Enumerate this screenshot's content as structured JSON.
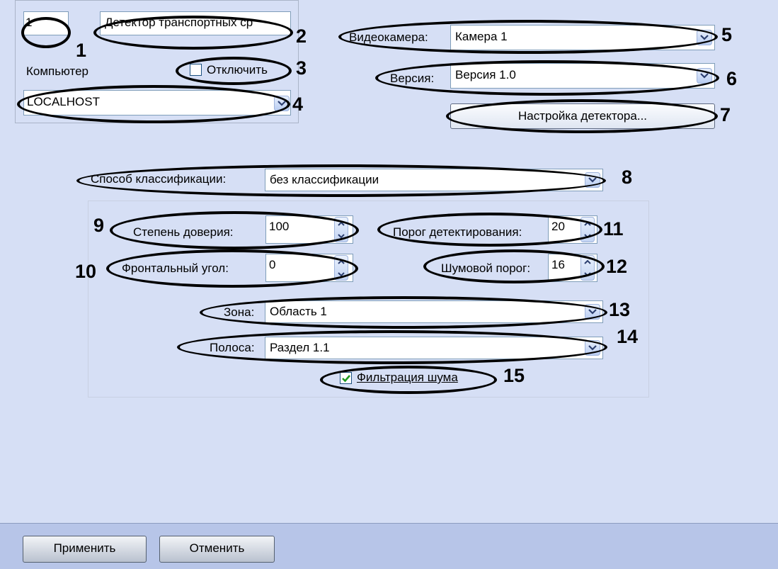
{
  "object_id": "1",
  "object_name": "Детектор транспортных ср",
  "computer": {
    "label": "Компьютер",
    "value": "LOCALHOST"
  },
  "disable": {
    "label": "Отключить",
    "checked": false
  },
  "camera": {
    "label": "Видеокамера:",
    "value": "Камера 1"
  },
  "version": {
    "label": "Версия:",
    "value": "Версия 1.0"
  },
  "detector_settings_button": "Настройка детектора...",
  "classification": {
    "label": "Способ классификации:",
    "value": "без классификации"
  },
  "confidence": {
    "label": "Степень доверия:",
    "value": "100"
  },
  "frontal_angle": {
    "label": "Фронтальный угол:",
    "value": "0"
  },
  "detection_threshold": {
    "label": "Порог детектирования:",
    "value": "20"
  },
  "noise_threshold": {
    "label": "Шумовой порог:",
    "value": "16"
  },
  "zone": {
    "label": "Зона:",
    "value": "Область 1"
  },
  "lane": {
    "label": "Полоса:",
    "value": "Раздел 1.1"
  },
  "noise_filter": {
    "label": "Фильтрация шума",
    "checked": true
  },
  "callouts": [
    "1",
    "2",
    "3",
    "4",
    "5",
    "6",
    "7",
    "8",
    "9",
    "10",
    "11",
    "12",
    "13",
    "14",
    "15"
  ],
  "footer": {
    "apply": "Применить",
    "cancel": "Отменить"
  },
  "icons": {
    "dropdown": "chevron-down-icon",
    "spin": "spin-arrows-icon",
    "check": "checkmark-icon"
  },
  "colors": {
    "panel_bg": "#d6dff5",
    "footer_bg": "#b7c5e8",
    "annotation": "#000000"
  }
}
